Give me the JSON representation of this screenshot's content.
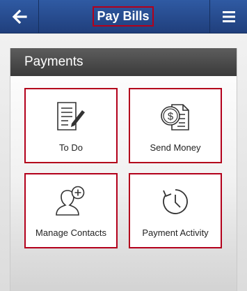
{
  "header": {
    "title": "Pay Bills",
    "back_icon": "back-arrow-icon",
    "menu_icon": "hamburger-menu-icon",
    "accent": "#b3001b",
    "bar_color": "#2a4f96"
  },
  "section": {
    "title": "Payments"
  },
  "tiles": [
    {
      "label": "To Do",
      "icon": "todo-list-icon"
    },
    {
      "label": "Send Money",
      "icon": "send-money-icon"
    },
    {
      "label": "Manage Contacts",
      "icon": "add-contact-icon"
    },
    {
      "label": "Payment Activity",
      "icon": "history-clock-icon"
    }
  ]
}
